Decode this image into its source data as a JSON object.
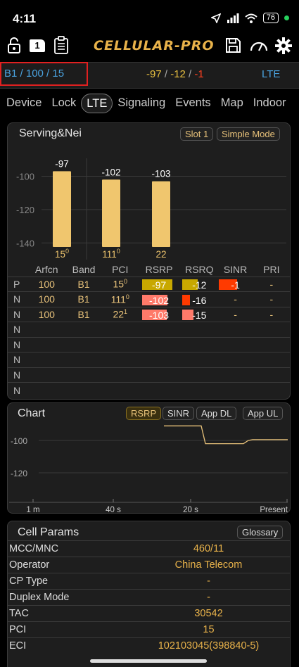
{
  "status": {
    "time": "4:11",
    "battery": "76"
  },
  "toolbar": {
    "sim_badge": "1",
    "app_title": "CELLULAR-PRO"
  },
  "info": {
    "band": "B1 / 100 / 15",
    "rsrp": "-97",
    "sep1": " / ",
    "rsrq": "-12",
    "sep2": " / ",
    "sinr": "-1",
    "tech": "LTE"
  },
  "tabs": [
    "Device",
    "Lock",
    "LTE",
    "Signaling",
    "Events",
    "Map",
    "Indoor"
  ],
  "serving": {
    "title": "Serving&Nei",
    "slot_btn": "Slot 1",
    "mode_btn": "Simple Mode",
    "chart_data": {
      "type": "bar",
      "categories": [
        "15",
        "111",
        "22"
      ],
      "category_superscripts": [
        "0",
        "0",
        ""
      ],
      "values": [
        -97,
        -102,
        -103
      ],
      "value_labels": [
        "-97",
        "-102",
        "-103"
      ],
      "y_ticks": [
        "-100",
        "-120",
        "-140"
      ],
      "ylim": [
        -150,
        -85
      ],
      "bar_color": "#f0c66e"
    },
    "table": {
      "headers": [
        "",
        "Arfcn",
        "Band",
        "PCI",
        "RSRP",
        "RSRQ",
        "SINR",
        "PRI"
      ],
      "rows": [
        {
          "type": "P",
          "arfcn": "100",
          "band": "B1",
          "pci": "15",
          "pci_sup": "0",
          "rsrp": "-97",
          "rsrq": "-12",
          "sinr": "-1",
          "pri": "-"
        },
        {
          "type": "N",
          "arfcn": "100",
          "band": "B1",
          "pci": "111",
          "pci_sup": "0",
          "rsrp": "-102",
          "rsrq": "-16",
          "sinr": "-",
          "pri": "-"
        },
        {
          "type": "N",
          "arfcn": "100",
          "band": "B1",
          "pci": "22",
          "pci_sup": "1",
          "rsrp": "-103",
          "rsrq": "-15",
          "sinr": "-",
          "pri": "-"
        },
        {
          "type": "N"
        },
        {
          "type": "N"
        },
        {
          "type": "N"
        },
        {
          "type": "N"
        },
        {
          "type": "N"
        }
      ],
      "rsrp_levels": [
        0.9,
        0.75,
        0.72
      ],
      "rsrp_colors": [
        "#c8a800",
        "#ff7a6a",
        "#ff7a6a"
      ],
      "rsrq_levels": [
        0.45,
        0.22,
        0.32
      ],
      "rsrq_colors": [
        "#c8a800",
        "#ff3a00",
        "#ff7a6a"
      ],
      "sinr_level": 0.55,
      "sinr_color": "#ff3a00"
    }
  },
  "chart": {
    "title": "Chart",
    "buttons": [
      "RSRP",
      "SINR",
      "App DL",
      "App UL"
    ],
    "y_ticks": [
      "-100",
      "-120"
    ],
    "x_ticks": [
      "1 m",
      "40 s",
      "20 s",
      "Present"
    ],
    "chart_data": {
      "type": "line",
      "x_labels": [
        "1 m",
        "40 s",
        "20 s",
        "Present"
      ],
      "series": [
        {
          "values": [
            -91,
            -91,
            -91,
            -102,
            -102,
            -102,
            -100,
            -99.5,
            -99.5
          ]
        }
      ],
      "ylim": [
        -130,
        -90
      ]
    }
  },
  "cell_params": {
    "title": "Cell Params",
    "glossary_btn": "Glossary",
    "rows": [
      {
        "k": "MCC/MNC",
        "v": "460/11"
      },
      {
        "k": "Operator",
        "v": "China Telecom"
      },
      {
        "k": "CP Type",
        "v": "-"
      },
      {
        "k": "Duplex Mode",
        "v": "-"
      },
      {
        "k": "TAC",
        "v": "30542"
      },
      {
        "k": "PCI",
        "v": "15"
      },
      {
        "k": "ECI",
        "v": "102103045(398840-5)"
      }
    ]
  }
}
